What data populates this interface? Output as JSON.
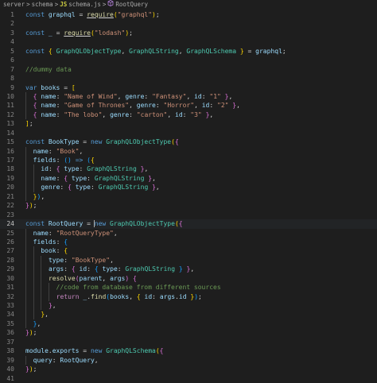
{
  "breadcrumb": {
    "items": [
      "server",
      "schema",
      "schema.js",
      "RootQuery"
    ],
    "separator": ">",
    "file_icon": "JS",
    "symbol_icon": "symbol-variable-icon"
  },
  "editor": {
    "active_line": 24,
    "lines": [
      "const graphql = require(\"graphql\");",
      "",
      "const _ = require(\"lodash\");",
      "",
      "const { GraphQLObjectType, GraphQLString, GraphQLSchema } = graphql;",
      "",
      "//dummy data",
      "",
      "var books = [",
      "  { name: \"Name of Wind\", genre: \"Fantasy\", id: \"1\" },",
      "  { name: \"Game of Thrones\", genre: \"Horror\", id: \"2\" },",
      "  { name: \"The lobo\", genre: \"carton\", id: \"3\" },",
      "];",
      "",
      "const BookType = new GraphQLObjectType({",
      "  name: \"Book\",",
      "  fields: () => ({",
      "    id: { type: GraphQLString },",
      "    name: { type: GraphQLString },",
      "    genre: { type: GraphQLString },",
      "  }),",
      "});",
      "",
      "const RootQuery = new GraphQLObjectType({",
      "  name: \"RootQueryType\",",
      "  fields: {",
      "    book: {",
      "      type: \"BookType\",",
      "      args: { id: { type: GraphQLString } },",
      "      resolve(parent, args) {",
      "        //code from database from different sources",
      "        return _.find(books, { id: args.id });",
      "      },",
      "    },",
      "  },",
      "});",
      "",
      "module.exports = new GraphQLSchema({",
      "  query: RootQuery,",
      "});",
      ""
    ]
  },
  "colors": {
    "background": "#1e1e1e",
    "keyword": "#569cd6",
    "variable": "#9cdcfe",
    "function": "#dcdcaa",
    "string": "#ce9178",
    "class": "#4ec9b0",
    "comment": "#6a9955",
    "control": "#c586c0"
  }
}
